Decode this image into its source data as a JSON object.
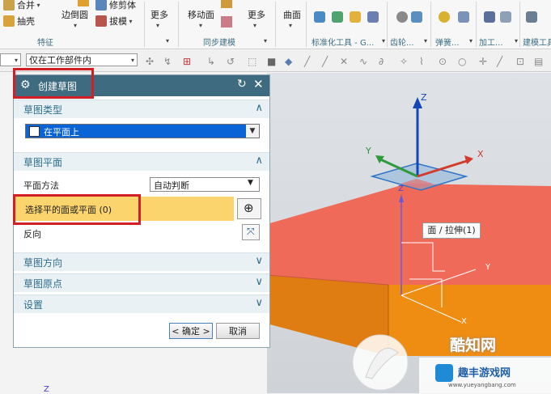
{
  "ribbon": {
    "items": {
      "merge": "合并",
      "extract": "抽壳",
      "edge_blend": "边倒圆",
      "trim_body": "修剪体",
      "draft": "拔模",
      "more1": "更多",
      "move_face": "移动面",
      "more2": "更多",
      "surface": "曲面"
    },
    "groups": {
      "feature": "特征",
      "sync_modeling": "同步建模",
      "std_tools": "标准化工具 - G...",
      "gear": "齿轮...",
      "spring": "弹簧...",
      "machining": "加工...",
      "build_tools": "建模工具"
    }
  },
  "toolbar": {
    "filter_value": "仅在工作部件内"
  },
  "dialog": {
    "title": "创建草图",
    "section_type": {
      "label": "草图类型",
      "selected": "在平面上"
    },
    "section_plane": {
      "label": "草图平面",
      "method_label": "平面方法",
      "method_value": "自动判断",
      "select_label": "选择平的面或平面 (0)",
      "reverse_label": "反向"
    },
    "section_orientation": "草图方向",
    "section_origin": "草图原点",
    "section_settings": "设置",
    "ok_label": "< 确定 >",
    "cancel_label": "取消"
  },
  "viewport": {
    "axis_z": "Z",
    "axis_y": "Y",
    "axis_x": "X",
    "axis_z2": "Z",
    "axis_y2": "Y",
    "axis_x2": "X",
    "tooltip": "面 / 拉伸(1)",
    "bottom_z": "Z"
  },
  "watermark": {
    "brand1": "酷知网",
    "brand2": "趣丰游戏网",
    "url": "www.yueyangbang.com"
  },
  "colors": {
    "title_bar": "#3e6b7f",
    "highlight_row": "#fbd46d",
    "select_blue": "#0a64d6",
    "box_top": "#f06a5a",
    "box_side": "#ef8c12",
    "annotation_red": "#d21f26"
  }
}
